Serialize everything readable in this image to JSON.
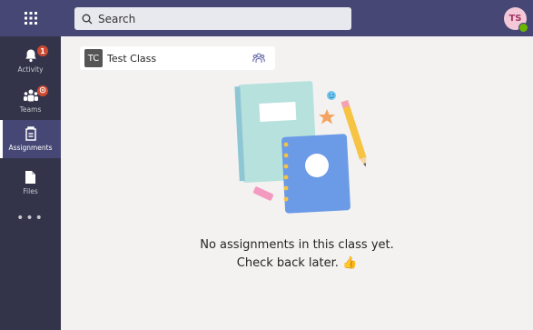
{
  "search": {
    "placeholder": "Search"
  },
  "user": {
    "initials": "TS",
    "presence": "available"
  },
  "rail": {
    "items": [
      {
        "label": "Activity",
        "badge": "1"
      },
      {
        "label": "Teams"
      },
      {
        "label": "Assignments",
        "active": true
      },
      {
        "label": "Files"
      }
    ],
    "more_label": "•••"
  },
  "class": {
    "initials": "TC",
    "name": "Test Class"
  },
  "empty_state": {
    "line1": "No assignments in this class yet.",
    "line2": "Check back later.",
    "emoji": "👍"
  },
  "colors": {
    "topbar": "#464775",
    "rail": "#33344a",
    "badge": "#cc4a31",
    "presence": "#6bb700"
  }
}
